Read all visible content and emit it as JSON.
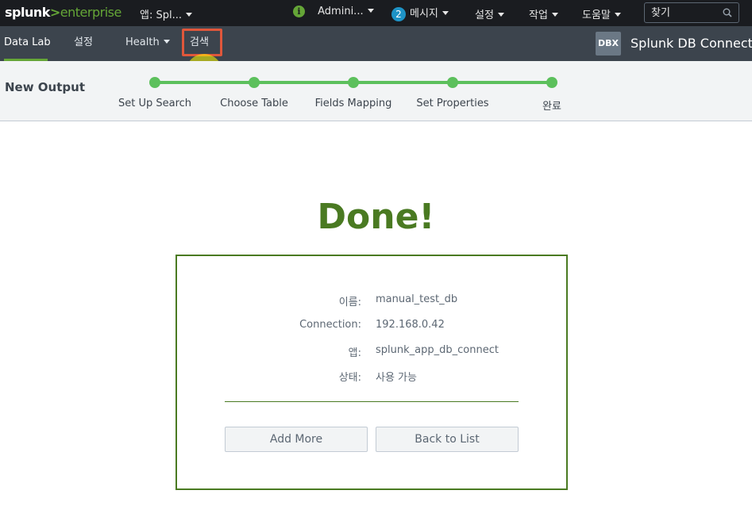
{
  "topbar": {
    "logo_left": "splunk",
    "logo_gt": ">",
    "logo_right": "enterprise",
    "app_menu": "앱: Spl...",
    "user_menu": "Admini...",
    "messages_count": "2",
    "messages_label": "메시지",
    "settings_label": "설정",
    "activity_label": "작업",
    "help_label": "도움말",
    "search_placeholder": "찾기",
    "colors": {
      "background": "#1a1c20",
      "accent": "#65a637",
      "badge": "#1e93c6"
    }
  },
  "appbar": {
    "items": [
      {
        "label": "Data Lab",
        "active": true
      },
      {
        "label": "설정",
        "active": false
      },
      {
        "label": "Health",
        "active": false
      },
      {
        "label": "검색",
        "active": false
      }
    ],
    "app_badge": "DBX",
    "app_title": "Splunk DB Connect",
    "colors": {
      "background": "#3c444d",
      "highlight": "#e0573b"
    }
  },
  "wizard": {
    "title": "New Output",
    "steps": [
      {
        "label": "Set Up Search"
      },
      {
        "label": "Choose Table"
      },
      {
        "label": "Fields Mapping"
      },
      {
        "label": "Set Properties"
      },
      {
        "label": "완료"
      }
    ],
    "colors": {
      "step": "#5cc05c"
    }
  },
  "result": {
    "title": "Done!",
    "fields": [
      {
        "key": "이름:",
        "value": "manual_test_db"
      },
      {
        "key": "Connection:",
        "value": "192.168.0.42"
      },
      {
        "key": "앱:",
        "value": "splunk_app_db_connect"
      },
      {
        "key": "상태:",
        "value": "사용 가능"
      }
    ],
    "add_more_label": "Add More",
    "back_to_list_label": "Back to List",
    "colors": {
      "success": "#4a7a22"
    }
  }
}
